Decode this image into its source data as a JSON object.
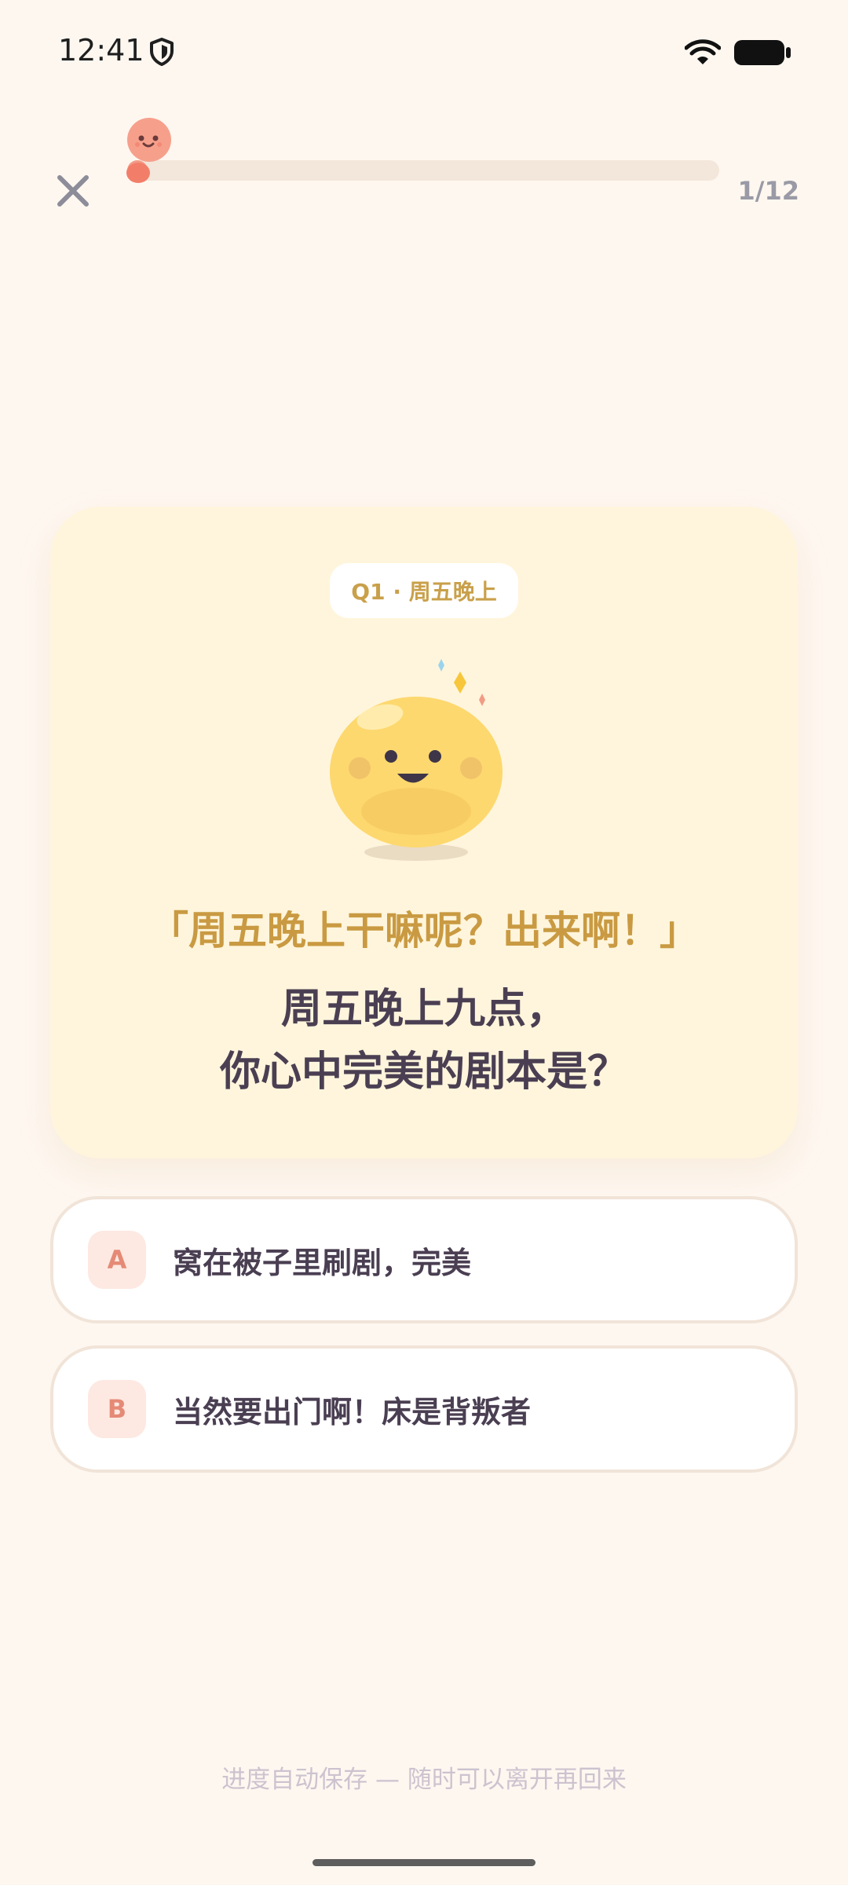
{
  "status_bar": {
    "time": "12:41",
    "icons": [
      "shield-icon",
      "wifi-icon",
      "battery-icon"
    ]
  },
  "header": {
    "close_icon": "close-icon",
    "progress_label": "1/12",
    "progress_fraction": 0.0833,
    "accent_color": "#F49B88"
  },
  "question": {
    "tag": "Q1 · 周五晚上",
    "quote": "「周五晚上干嘛呢？出来啊！」",
    "lines": [
      "周五晚上九点，",
      "你心中完美的剧本是？"
    ],
    "illustration": "smiling-yellow-blob"
  },
  "options": [
    {
      "letter": "A",
      "text": "窝在被子里刷剧，完美"
    },
    {
      "letter": "B",
      "text": "当然要出门啊！床是背叛者"
    }
  ],
  "footer": {
    "note": "进度自动保存 — 随时可以离开再回来"
  },
  "colors": {
    "background": "#FEF7F0",
    "card": "#FFF5DC",
    "quote": "#C99A42",
    "text": "#4A3F52",
    "badge": "#FDE9E2"
  }
}
